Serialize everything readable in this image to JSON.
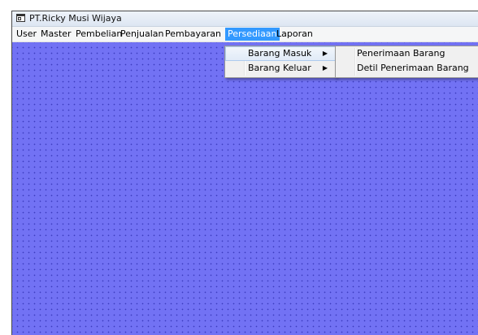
{
  "window": {
    "title": "PT.Ricky Musi Wijaya"
  },
  "menubar": {
    "items": [
      {
        "label": "User"
      },
      {
        "label": "Master"
      },
      {
        "label": "Pembelian"
      },
      {
        "label": "Penjualan"
      },
      {
        "label": "Pembayaran"
      },
      {
        "label": "Persediaan",
        "active": true
      },
      {
        "label": "Laporan"
      }
    ]
  },
  "persediaan_menu": {
    "items": [
      {
        "label": "Barang Masuk",
        "has_submenu": true,
        "highlighted": true
      },
      {
        "label": "Barang Keluar",
        "has_submenu": true
      }
    ]
  },
  "barang_masuk_submenu": {
    "items": [
      {
        "label": "Penerimaan Barang"
      },
      {
        "label": "Detil Penerimaan Barang"
      }
    ]
  },
  "colors": {
    "mdi_background": "#7272f4",
    "menu_highlight": "#3399ff"
  },
  "icons": {
    "app": "window-icon",
    "submenu_arrow": "triangle-right-icon"
  }
}
